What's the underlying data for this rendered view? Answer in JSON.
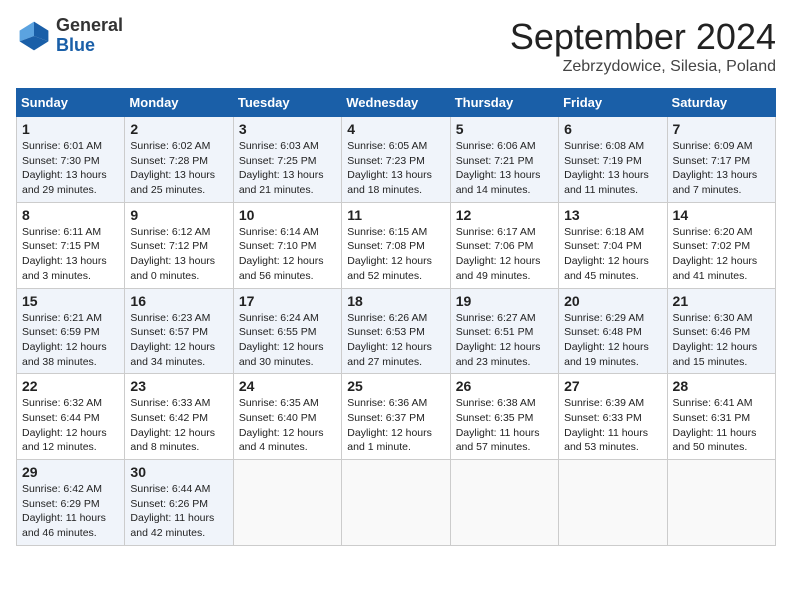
{
  "header": {
    "logo_general": "General",
    "logo_blue": "Blue",
    "title": "September 2024",
    "location": "Zebrzydowice, Silesia, Poland"
  },
  "weekdays": [
    "Sunday",
    "Monday",
    "Tuesday",
    "Wednesday",
    "Thursday",
    "Friday",
    "Saturday"
  ],
  "weeks": [
    [
      {
        "day": "1",
        "lines": [
          "Sunrise: 6:01 AM",
          "Sunset: 7:30 PM",
          "Daylight: 13 hours",
          "and 29 minutes."
        ]
      },
      {
        "day": "2",
        "lines": [
          "Sunrise: 6:02 AM",
          "Sunset: 7:28 PM",
          "Daylight: 13 hours",
          "and 25 minutes."
        ]
      },
      {
        "day": "3",
        "lines": [
          "Sunrise: 6:03 AM",
          "Sunset: 7:25 PM",
          "Daylight: 13 hours",
          "and 21 minutes."
        ]
      },
      {
        "day": "4",
        "lines": [
          "Sunrise: 6:05 AM",
          "Sunset: 7:23 PM",
          "Daylight: 13 hours",
          "and 18 minutes."
        ]
      },
      {
        "day": "5",
        "lines": [
          "Sunrise: 6:06 AM",
          "Sunset: 7:21 PM",
          "Daylight: 13 hours",
          "and 14 minutes."
        ]
      },
      {
        "day": "6",
        "lines": [
          "Sunrise: 6:08 AM",
          "Sunset: 7:19 PM",
          "Daylight: 13 hours",
          "and 11 minutes."
        ]
      },
      {
        "day": "7",
        "lines": [
          "Sunrise: 6:09 AM",
          "Sunset: 7:17 PM",
          "Daylight: 13 hours",
          "and 7 minutes."
        ]
      }
    ],
    [
      {
        "day": "8",
        "lines": [
          "Sunrise: 6:11 AM",
          "Sunset: 7:15 PM",
          "Daylight: 13 hours",
          "and 3 minutes."
        ]
      },
      {
        "day": "9",
        "lines": [
          "Sunrise: 6:12 AM",
          "Sunset: 7:12 PM",
          "Daylight: 13 hours",
          "and 0 minutes."
        ]
      },
      {
        "day": "10",
        "lines": [
          "Sunrise: 6:14 AM",
          "Sunset: 7:10 PM",
          "Daylight: 12 hours",
          "and 56 minutes."
        ]
      },
      {
        "day": "11",
        "lines": [
          "Sunrise: 6:15 AM",
          "Sunset: 7:08 PM",
          "Daylight: 12 hours",
          "and 52 minutes."
        ]
      },
      {
        "day": "12",
        "lines": [
          "Sunrise: 6:17 AM",
          "Sunset: 7:06 PM",
          "Daylight: 12 hours",
          "and 49 minutes."
        ]
      },
      {
        "day": "13",
        "lines": [
          "Sunrise: 6:18 AM",
          "Sunset: 7:04 PM",
          "Daylight: 12 hours",
          "and 45 minutes."
        ]
      },
      {
        "day": "14",
        "lines": [
          "Sunrise: 6:20 AM",
          "Sunset: 7:02 PM",
          "Daylight: 12 hours",
          "and 41 minutes."
        ]
      }
    ],
    [
      {
        "day": "15",
        "lines": [
          "Sunrise: 6:21 AM",
          "Sunset: 6:59 PM",
          "Daylight: 12 hours",
          "and 38 minutes."
        ]
      },
      {
        "day": "16",
        "lines": [
          "Sunrise: 6:23 AM",
          "Sunset: 6:57 PM",
          "Daylight: 12 hours",
          "and 34 minutes."
        ]
      },
      {
        "day": "17",
        "lines": [
          "Sunrise: 6:24 AM",
          "Sunset: 6:55 PM",
          "Daylight: 12 hours",
          "and 30 minutes."
        ]
      },
      {
        "day": "18",
        "lines": [
          "Sunrise: 6:26 AM",
          "Sunset: 6:53 PM",
          "Daylight: 12 hours",
          "and 27 minutes."
        ]
      },
      {
        "day": "19",
        "lines": [
          "Sunrise: 6:27 AM",
          "Sunset: 6:51 PM",
          "Daylight: 12 hours",
          "and 23 minutes."
        ]
      },
      {
        "day": "20",
        "lines": [
          "Sunrise: 6:29 AM",
          "Sunset: 6:48 PM",
          "Daylight: 12 hours",
          "and 19 minutes."
        ]
      },
      {
        "day": "21",
        "lines": [
          "Sunrise: 6:30 AM",
          "Sunset: 6:46 PM",
          "Daylight: 12 hours",
          "and 15 minutes."
        ]
      }
    ],
    [
      {
        "day": "22",
        "lines": [
          "Sunrise: 6:32 AM",
          "Sunset: 6:44 PM",
          "Daylight: 12 hours",
          "and 12 minutes."
        ]
      },
      {
        "day": "23",
        "lines": [
          "Sunrise: 6:33 AM",
          "Sunset: 6:42 PM",
          "Daylight: 12 hours",
          "and 8 minutes."
        ]
      },
      {
        "day": "24",
        "lines": [
          "Sunrise: 6:35 AM",
          "Sunset: 6:40 PM",
          "Daylight: 12 hours",
          "and 4 minutes."
        ]
      },
      {
        "day": "25",
        "lines": [
          "Sunrise: 6:36 AM",
          "Sunset: 6:37 PM",
          "Daylight: 12 hours",
          "and 1 minute."
        ]
      },
      {
        "day": "26",
        "lines": [
          "Sunrise: 6:38 AM",
          "Sunset: 6:35 PM",
          "Daylight: 11 hours",
          "and 57 minutes."
        ]
      },
      {
        "day": "27",
        "lines": [
          "Sunrise: 6:39 AM",
          "Sunset: 6:33 PM",
          "Daylight: 11 hours",
          "and 53 minutes."
        ]
      },
      {
        "day": "28",
        "lines": [
          "Sunrise: 6:41 AM",
          "Sunset: 6:31 PM",
          "Daylight: 11 hours",
          "and 50 minutes."
        ]
      }
    ],
    [
      {
        "day": "29",
        "lines": [
          "Sunrise: 6:42 AM",
          "Sunset: 6:29 PM",
          "Daylight: 11 hours",
          "and 46 minutes."
        ]
      },
      {
        "day": "30",
        "lines": [
          "Sunrise: 6:44 AM",
          "Sunset: 6:26 PM",
          "Daylight: 11 hours",
          "and 42 minutes."
        ]
      },
      {
        "day": "",
        "lines": []
      },
      {
        "day": "",
        "lines": []
      },
      {
        "day": "",
        "lines": []
      },
      {
        "day": "",
        "lines": []
      },
      {
        "day": "",
        "lines": []
      }
    ]
  ]
}
